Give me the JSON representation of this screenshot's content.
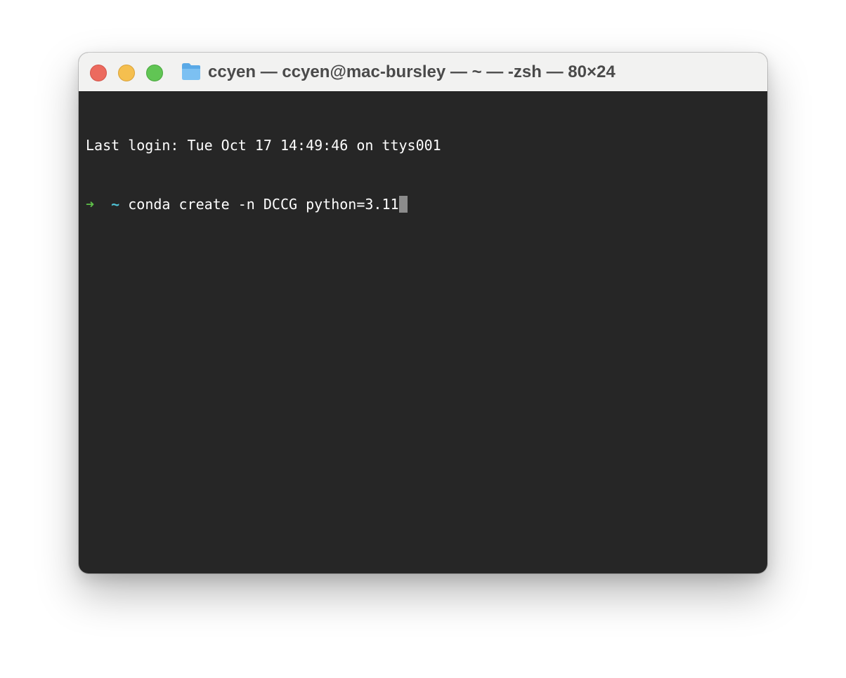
{
  "window": {
    "title": "ccyen — ccyen@mac-bursley — ~ — -zsh — 80×24",
    "folder_icon": "folder-icon",
    "traffic_lights": {
      "close_color": "#ec6a5e",
      "minimize_color": "#f5bf4f",
      "zoom_color": "#61c554"
    }
  },
  "terminal": {
    "background": "#262626",
    "last_login": "Last login: Tue Oct 17 14:49:46 on ttys001",
    "prompt_arrow": "➜",
    "prompt_dir": "~",
    "command": "conda create -n DCCG python=3.11"
  }
}
